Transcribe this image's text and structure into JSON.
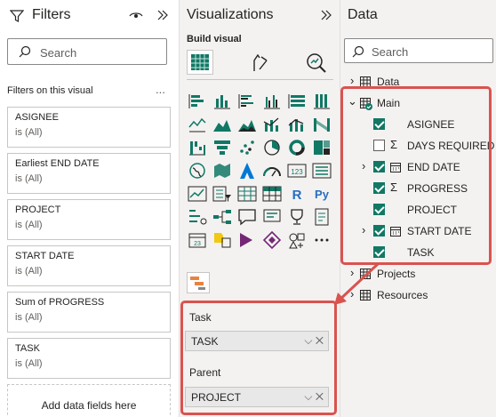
{
  "filters": {
    "title": "Filters",
    "search_placeholder": "Search",
    "section_label": "Filters on this visual",
    "more": "...",
    "cards": [
      {
        "name": "ASIGNEE",
        "value": "is (All)"
      },
      {
        "name": "Earliest END DATE",
        "value": "is (All)"
      },
      {
        "name": "PROJECT",
        "value": "is (All)"
      },
      {
        "name": "START DATE",
        "value": "is (All)"
      },
      {
        "name": "Sum of PROGRESS",
        "value": "is (All)"
      },
      {
        "name": "TASK",
        "value": "is (All)"
      }
    ],
    "add_label": "Add data fields here"
  },
  "visualizations": {
    "title": "Visualizations",
    "build_label": "Build visual",
    "field_wells": [
      {
        "label": "Task",
        "value": "TASK"
      },
      {
        "label": "Parent",
        "value": "PROJECT"
      }
    ],
    "well_controls": "⌵ ✕"
  },
  "data": {
    "title": "Data",
    "search_placeholder": "Search",
    "tables": [
      {
        "label": "Data"
      },
      {
        "label": "Main"
      },
      {
        "label": "Projects"
      },
      {
        "label": "Resources"
      }
    ],
    "main_fields": [
      {
        "label": "ASIGNEE",
        "checked": true
      },
      {
        "label": "DAYS REQUIRED",
        "checked": false
      },
      {
        "label": "END DATE",
        "checked": true
      },
      {
        "label": "PROGRESS",
        "checked": true
      },
      {
        "label": "PROJECT",
        "checked": true
      },
      {
        "label": "START DATE",
        "checked": true
      },
      {
        "label": "TASK",
        "checked": true
      }
    ]
  },
  "colors": {
    "accent": "#117865",
    "highlight": "#d9534f"
  }
}
